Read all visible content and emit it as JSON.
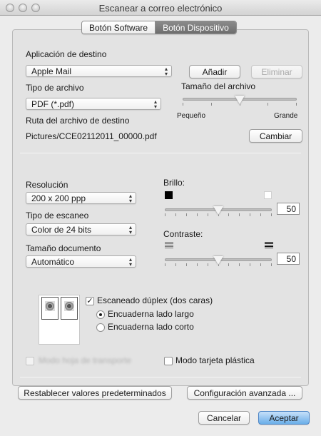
{
  "window": {
    "title": "Escanear a correo electrónico"
  },
  "tabs": [
    {
      "label": "Botón Software",
      "active": false
    },
    {
      "label": "Botón Dispositivo",
      "active": true
    }
  ],
  "destination": {
    "label": "Aplicación de destino",
    "value": "Apple Mail",
    "add_label": "Añadir",
    "remove_label": "Eliminar"
  },
  "file_type": {
    "label": "Tipo de archivo",
    "value": "PDF (*.pdf)"
  },
  "file_size": {
    "label": "Tamaño del archivo",
    "min_label": "Pequeño",
    "max_label": "Grande",
    "level": 0.5
  },
  "path": {
    "label": "Ruta del archivo de destino",
    "value": "Pictures/CCE02112011_00000.pdf",
    "change_label": "Cambiar"
  },
  "resolution": {
    "label": "Resolución",
    "value": "200 x 200 ppp"
  },
  "scan_type": {
    "label": "Tipo de escaneo",
    "value": "Color de 24 bits"
  },
  "document_size": {
    "label": "Tamaño documento",
    "value": "Automático"
  },
  "brightness": {
    "label": "Brillo:",
    "value": "50",
    "level": 0.5
  },
  "contrast": {
    "label": "Contraste:",
    "value": "50",
    "level": 0.5
  },
  "duplex": {
    "label": "Escaneado dúplex (dos caras)",
    "checked": true,
    "long_edge_label": "Encuaderna lado largo",
    "short_edge_label": "Encuaderna lado corto"
  },
  "carrier_sheet": {
    "label": "Modo hoja de transporte",
    "enabled": false
  },
  "plastic_card": {
    "label": "Modo tarjeta plástica",
    "checked": false
  },
  "restore_defaults_label": "Restablecer valores predeterminados",
  "advanced_label": "Configuración avanzada ...",
  "cancel_label": "Cancelar",
  "accept_label": "Aceptar",
  "colors": {
    "accent": "#6aaee9",
    "window": "#ececec",
    "panel": "#e3e3e3"
  }
}
